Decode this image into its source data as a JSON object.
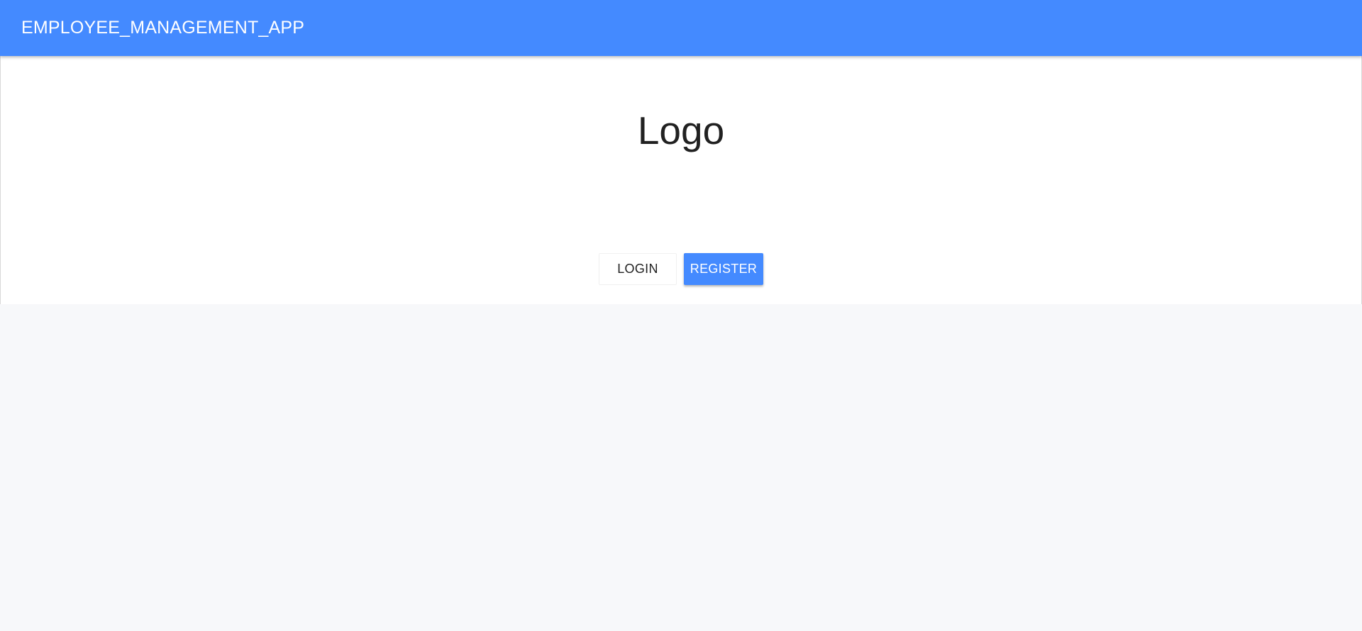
{
  "app_bar": {
    "title": "EMPLOYEE_MANAGEMENT_APP"
  },
  "hero": {
    "logo_text": "Logo",
    "login_label": "LOGIN",
    "register_label": "REGISTER"
  },
  "colors": {
    "primary": "#448aff",
    "background": "#f7f8fa",
    "surface": "#ffffff",
    "text": "#212121"
  }
}
